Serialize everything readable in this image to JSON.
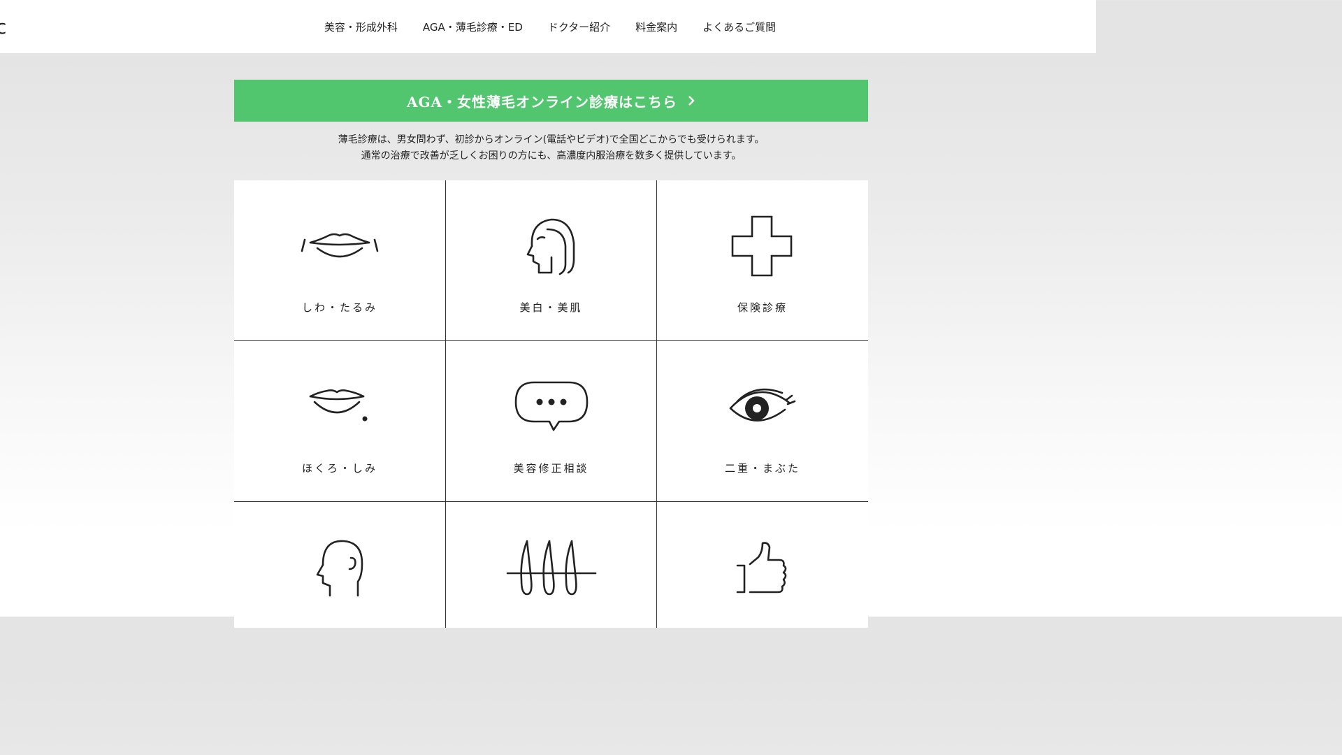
{
  "header": {
    "logo_fragment": "c",
    "nav": [
      {
        "label": "美容・形成外科"
      },
      {
        "label": "AGA・薄毛診療・ED"
      },
      {
        "label": "ドクター紹介"
      },
      {
        "label": "料金案内"
      },
      {
        "label": "よくあるご質問"
      }
    ]
  },
  "banner": {
    "label": "AGA・女性薄毛オンライン診療はこちら",
    "chevron_icon": "chevron-right-icon",
    "color": "#52c66e"
  },
  "description": {
    "line1": "薄毛診療は、男女問わず、初診からオンライン(電話やビデオ)で全国どこからでも受けられます。",
    "line2": "通常の治療で改善が乏しくお困りの方にも、高濃度内服治療を数多く提供しています。"
  },
  "menu": [
    {
      "label": "しわ・たるみ",
      "icon": "lips-wrinkle-icon"
    },
    {
      "label": "美白・美肌",
      "icon": "woman-profile-icon"
    },
    {
      "label": "保険診療",
      "icon": "medical-cross-icon"
    },
    {
      "label": "ほくろ・しみ",
      "icon": "lips-mole-icon"
    },
    {
      "label": "美容修正相談",
      "icon": "speech-bubble-icon"
    },
    {
      "label": "二重・まぶた",
      "icon": "eye-icon"
    },
    {
      "label": "",
      "icon": "head-profile-icon"
    },
    {
      "label": "",
      "icon": "hair-follicle-icon"
    },
    {
      "label": "",
      "icon": "thumbs-up-icon"
    }
  ]
}
